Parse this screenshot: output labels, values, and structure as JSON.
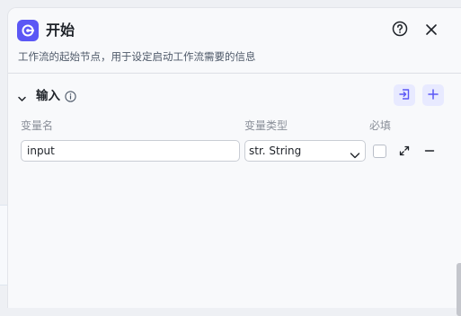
{
  "header": {
    "title": "开始",
    "description": "工作流的起始节点，用于设定启动工作流需要的信息",
    "icons": {
      "node": "start-node-icon",
      "help": "help-circle-icon",
      "close": "close-icon"
    }
  },
  "input_section": {
    "title": "输入",
    "info_icon": "info-icon",
    "actions": {
      "import": "import-icon",
      "add": "plus-icon"
    }
  },
  "table": {
    "columns": [
      "变量名",
      "变量类型",
      "必填"
    ],
    "rows": [
      {
        "name": "input",
        "type": "str. String",
        "required": false
      }
    ]
  },
  "colors": {
    "accent": "#5b57f5",
    "accent_soft": "#e8eaff",
    "panel_bg": "#f8f9fb"
  }
}
